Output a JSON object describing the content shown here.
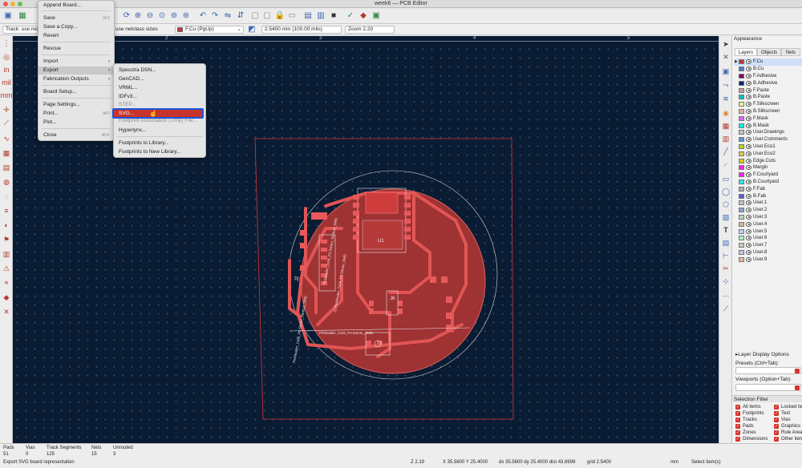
{
  "window": {
    "title": "week6 — PCB Editor"
  },
  "aux": {
    "track_label": "Track: use net",
    "netclass_label": "use netclass sizes",
    "layer_value": "F.Cu (PgUp)",
    "grid_value": "2.5400 mm (100.00 mils)",
    "zoom_value": "Zoom 2.20"
  },
  "ruler": [
    "2",
    "3",
    "4",
    "5"
  ],
  "file_menu": {
    "items": [
      {
        "label": "Append Board..."
      },
      {
        "label": "Save",
        "shortcut": "⌘S"
      },
      {
        "label": "Save a Copy..."
      },
      {
        "label": "Revert"
      },
      {
        "label": "Rescue"
      },
      {
        "label": "Import"
      },
      {
        "label": "Export"
      },
      {
        "label": "Fabrication Outputs"
      },
      {
        "label": "Board Setup..."
      },
      {
        "label": "Page Settings..."
      },
      {
        "label": "Print...",
        "shortcut": "⌘P"
      },
      {
        "label": "Plot..."
      },
      {
        "label": "Close",
        "shortcut": "⌘W"
      }
    ]
  },
  "export_menu": {
    "items": [
      {
        "label": "Specctra DSN..."
      },
      {
        "label": "GenCAD..."
      },
      {
        "label": "VRML..."
      },
      {
        "label": "IDFv3..."
      },
      {
        "label": "STEP..."
      },
      {
        "label": "SVG..."
      },
      {
        "label": "Footprint Association (.cmp) File..."
      },
      {
        "label": "Hyperlynx..."
      },
      {
        "label": "Footprints to Library..."
      },
      {
        "label": "Footprints to New Library..."
      }
    ]
  },
  "appearance": {
    "title": "Appearance",
    "tabs": [
      "Layers",
      "Objects",
      "Nets"
    ],
    "layers": [
      {
        "name": "F.Cu",
        "color": "#c83434"
      },
      {
        "name": "B.Cu",
        "color": "#4d7fc4"
      },
      {
        "name": "F.Adhesive",
        "color": "#84005f"
      },
      {
        "name": "B.Adhesive",
        "color": "#00237e"
      },
      {
        "name": "F.Paste",
        "color": "#b4a0a0"
      },
      {
        "name": "B.Paste",
        "color": "#00c2c2"
      },
      {
        "name": "F.Silkscreen",
        "color": "#f2eda1"
      },
      {
        "name": "B.Silkscreen",
        "color": "#e8b2a7"
      },
      {
        "name": "F.Mask",
        "color": "#d864ff"
      },
      {
        "name": "B.Mask",
        "color": "#02ffee"
      },
      {
        "name": "User.Drawings",
        "color": "#c2c2c2"
      },
      {
        "name": "User.Comments",
        "color": "#5994dc"
      },
      {
        "name": "User.Eco1",
        "color": "#b4db1e"
      },
      {
        "name": "User.Eco2",
        "color": "#d8c852"
      },
      {
        "name": "Edge.Cuts",
        "color": "#d0d200"
      },
      {
        "name": "Margin",
        "color": "#ff26e2"
      },
      {
        "name": "F.Courtyard",
        "color": "#ff26e2"
      },
      {
        "name": "B.Courtyard",
        "color": "#26e9ff"
      },
      {
        "name": "F.Fab",
        "color": "#afafaf"
      },
      {
        "name": "B.Fab",
        "color": "#585dd4"
      },
      {
        "name": "User.1",
        "color": "#c2c2c2"
      },
      {
        "name": "User.2",
        "color": "#89a5d1"
      },
      {
        "name": "User.3",
        "color": "#b4dbb2"
      },
      {
        "name": "User.4",
        "color": "#d8b5a2"
      },
      {
        "name": "User.5",
        "color": "#c4c9ff"
      },
      {
        "name": "User.6",
        "color": "#aaf2c0"
      },
      {
        "name": "User.7",
        "color": "#d0c7b1"
      },
      {
        "name": "User.8",
        "color": "#c9c5e6"
      },
      {
        "name": "User.9",
        "color": "#e8b69d"
      }
    ],
    "layer_display_options": "Layer Display Options",
    "presets_label": "Presets (Ctrl+Tab):",
    "viewports_label": "Viewports (Option+Tab):"
  },
  "selection_filter": {
    "title": "Selection Filter",
    "items": [
      "All items",
      "Locked items",
      "Footprints",
      "Text",
      "Tracks",
      "Vias",
      "Pads",
      "Graphics",
      "Zones",
      "Rule Areas",
      "Dimensions",
      "Other items"
    ]
  },
  "status": {
    "pads_label": "Pads",
    "pads_value": "51",
    "vias_label": "Vias",
    "vias_value": "0",
    "segments_label": "Track Segments",
    "segments_value": "125",
    "nets_label": "Nets",
    "nets_value": "15",
    "unrouted_label": "Unrouted",
    "unrouted_value": "3",
    "message": "Export SVG board representation",
    "zoom": "Z 2.19",
    "xy": "X 35.5600  Y 25.4000",
    "dxy": "dx 35.5600  dy 25.4000  dist 43.6998",
    "grid": "grid 2.5400",
    "units": "mm",
    "mode": "Select item(s)"
  },
  "board": {
    "labels": [
      "U1",
      "J6",
      "J2"
    ],
    "silk_texts": [
      "Pinheader_1x04_P2.54mm_Vertical_SMD",
      "J1 PinHeader_1x04_P2.54mm_SMD",
      "PinHeader_1x06_P2.54mm_Vertical_SMD",
      "Pinheader_1x03_P2.54mm_SMD"
    ]
  }
}
